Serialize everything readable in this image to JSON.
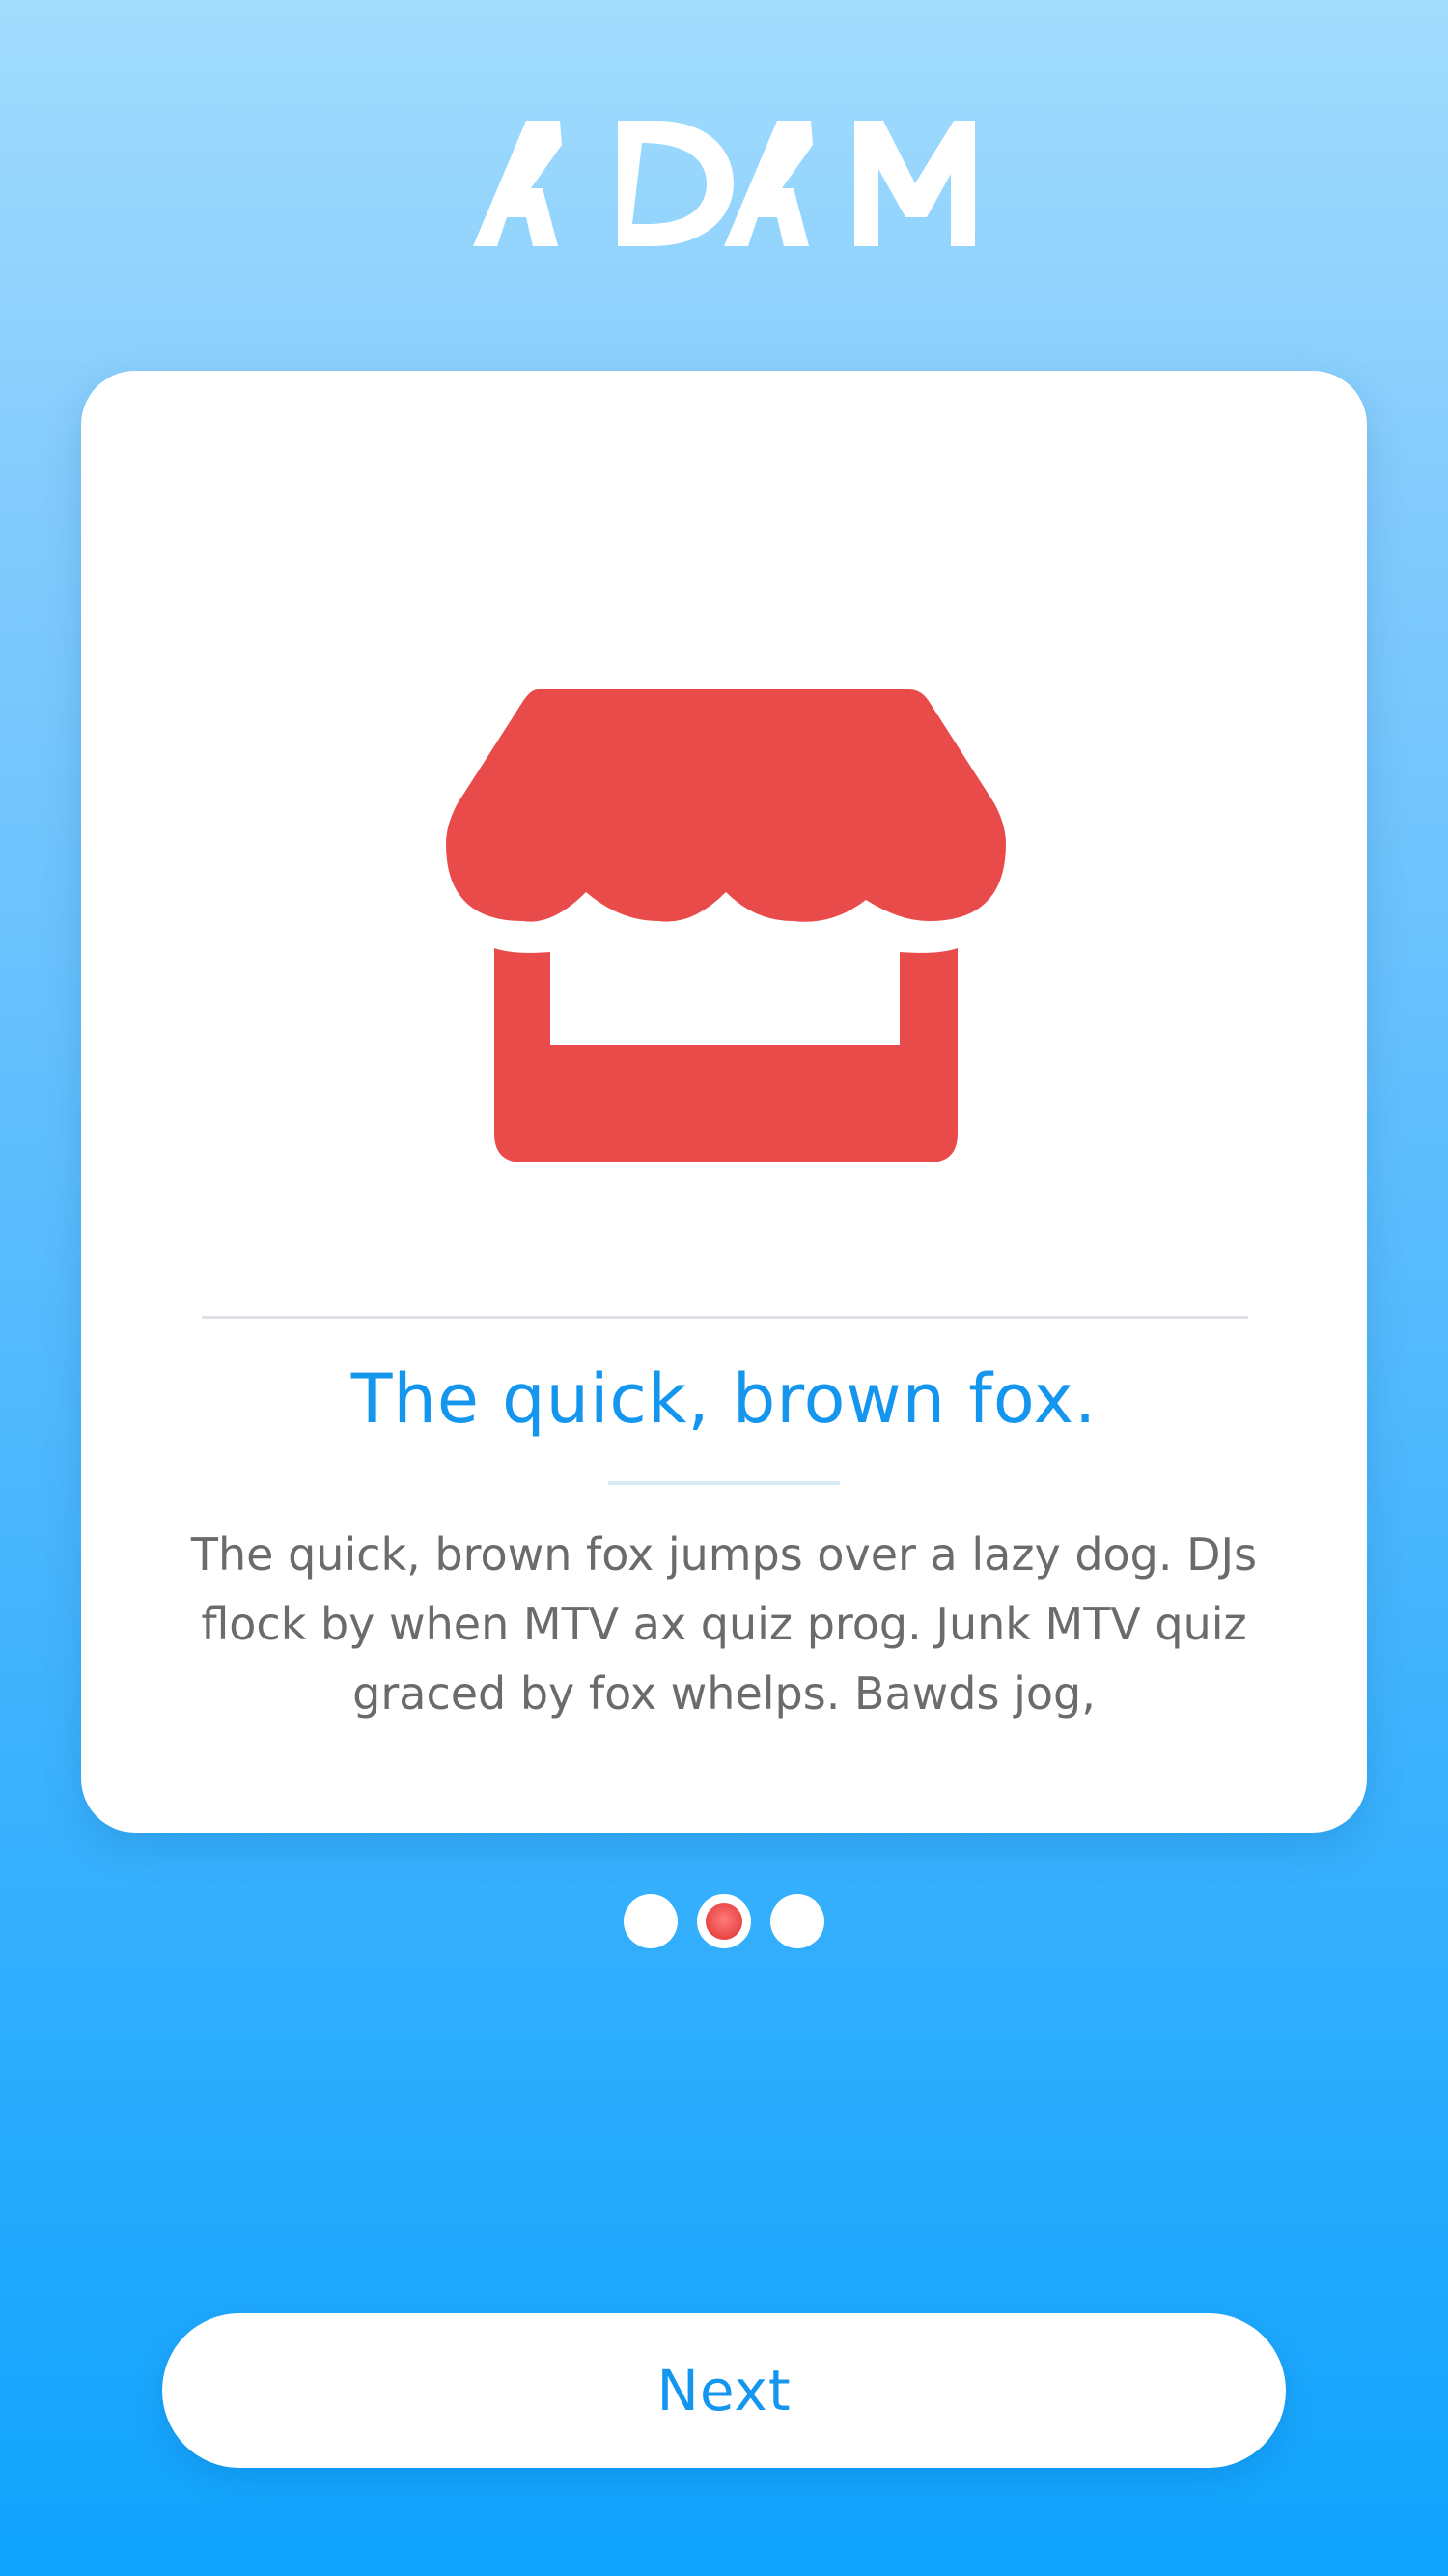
{
  "app": {
    "logo_text": "ADAM",
    "logo_color": "#ffffff"
  },
  "card": {
    "icon": "storefront-icon",
    "icon_color": "#e94b4b",
    "title": "The quick, brown fox.",
    "body": "The quick, brown fox jumps over a lazy dog. DJs flock by when MTV ax quiz prog. Junk MTV quiz graced by fox whelps. Bawds jog,"
  },
  "pagination": {
    "total": 3,
    "active_index": 1,
    "active_color": "#e84545"
  },
  "actions": {
    "next_label": "Next"
  },
  "colors": {
    "accent": "#1496ef",
    "background_top": "#a2dcfd",
    "background_bottom": "#0fa3fd"
  }
}
